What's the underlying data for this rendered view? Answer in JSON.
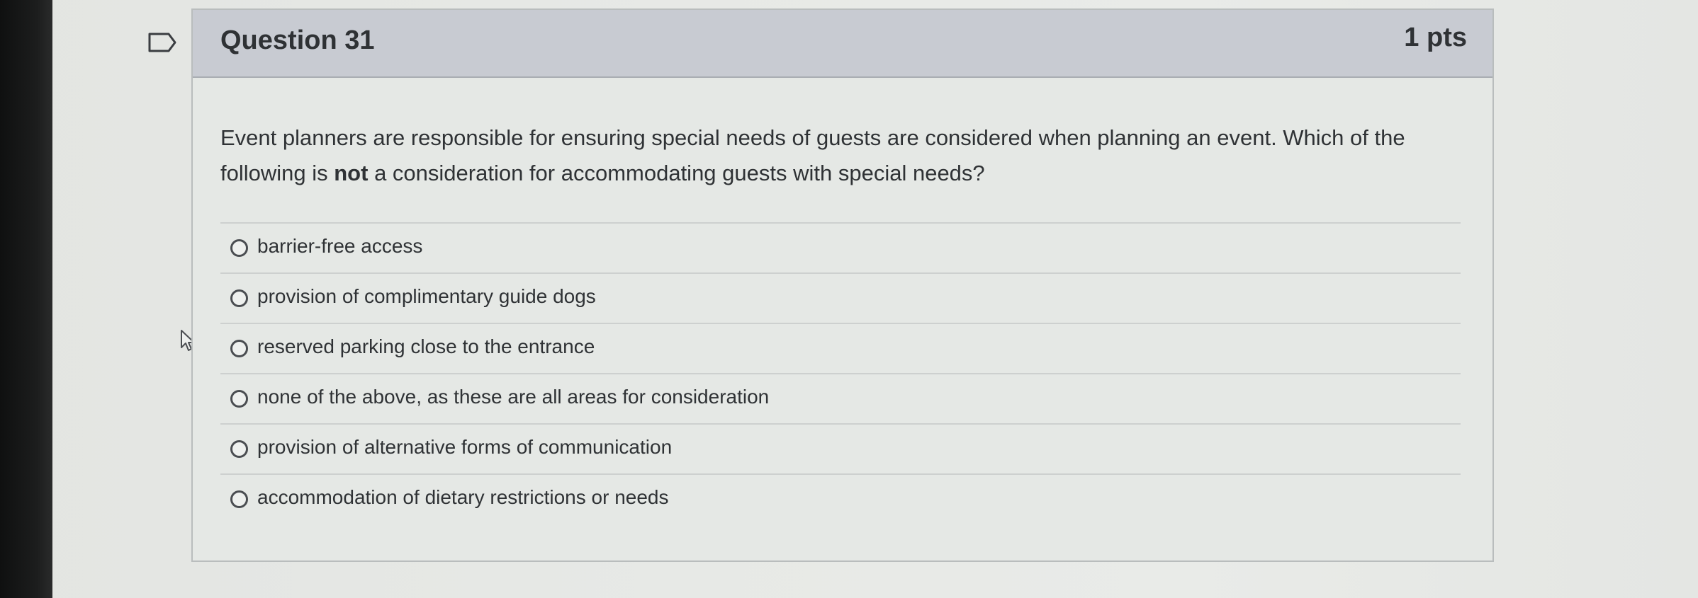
{
  "question": {
    "title": "Question 31",
    "points": "1 pts",
    "text_before": "Event planners are responsible for ensuring special needs of guests are considered when planning an event. Which of the following is ",
    "text_emphasis": "not",
    "text_after": " a consideration for accommodating guests with special needs?",
    "flag_icon": "flag-bookmark-icon",
    "answers": [
      {
        "label": "barrier-free access",
        "selected": false
      },
      {
        "label": "provision of complimentary guide dogs",
        "selected": false
      },
      {
        "label": "reserved parking close to the entrance",
        "selected": false
      },
      {
        "label": "none of the above, as these are all areas for consideration",
        "selected": false
      },
      {
        "label": "provision of alternative forms of communication",
        "selected": false
      },
      {
        "label": "accommodation of dietary restrictions or needs",
        "selected": false
      }
    ]
  },
  "colors": {
    "header_bg": "#c8cbd2",
    "card_bg": "#e5e8e5",
    "text": "#2f3235"
  }
}
